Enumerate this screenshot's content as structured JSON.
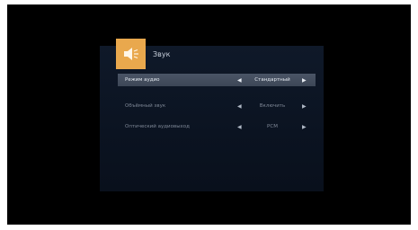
{
  "panel": {
    "title": "Звук",
    "icon": "speaker-icon",
    "accent_color": "#e9a84d"
  },
  "settings": [
    {
      "label": "Режим аудио",
      "value": "Стандартный",
      "selected": true
    },
    {
      "label": "Объёмный звук",
      "value": "Включить",
      "selected": false
    },
    {
      "label": "Оптический аудиовыход",
      "value": "PCM",
      "selected": false
    }
  ],
  "arrows": {
    "left": "◀",
    "right": "▶"
  }
}
